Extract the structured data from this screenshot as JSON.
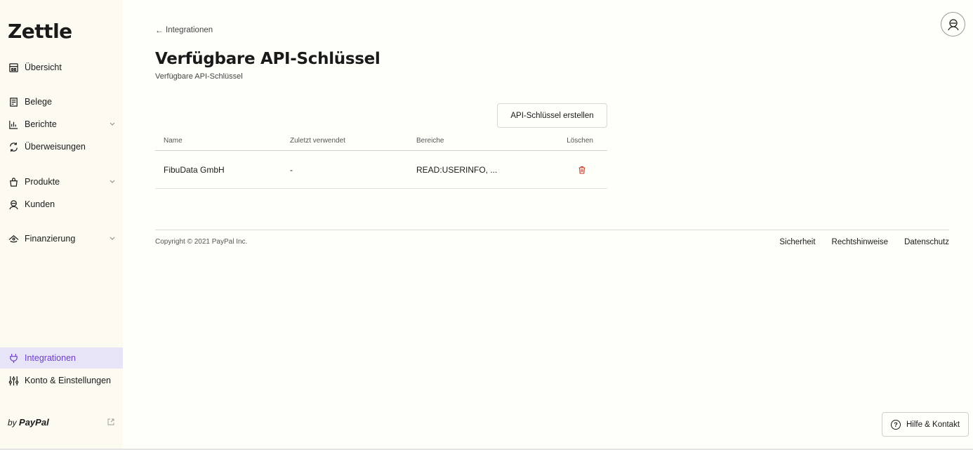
{
  "brand": {
    "logo": "Zettle",
    "by": "by",
    "paypal": "PayPal"
  },
  "sidebar": {
    "items": [
      {
        "label": "Übersicht"
      },
      {
        "label": "Belege"
      },
      {
        "label": "Berichte"
      },
      {
        "label": "Überweisungen"
      },
      {
        "label": "Produkte"
      },
      {
        "label": "Kunden"
      },
      {
        "label": "Finanzierung"
      },
      {
        "label": "Integrationen"
      },
      {
        "label": "Konto & Einstellungen"
      }
    ],
    "active": "Integrationen"
  },
  "breadcrumb": {
    "back_label": "Integrationen"
  },
  "page": {
    "title": "Verfügbare API-Schlüssel",
    "subtitle": "Verfügbare API-Schlüssel",
    "create_button": "API-Schlüssel erstellen"
  },
  "table": {
    "headers": [
      "Name",
      "Zuletzt verwendet",
      "Bereiche",
      "Löschen"
    ],
    "rows": [
      {
        "name": "FibuData GmbH",
        "last_used": "-",
        "scopes": "READ:USERINFO, ..."
      }
    ]
  },
  "footer": {
    "copyright": "Copyright © 2021 PayPal Inc.",
    "links": [
      "Sicherheit",
      "Rechtshinweise",
      "Datenschutz"
    ]
  },
  "help": {
    "label": "Hilfe & Kontakt"
  },
  "colors": {
    "accent": "#6c3fd0",
    "active_bg": "#e8e4f7",
    "delete": "#c0392b"
  }
}
